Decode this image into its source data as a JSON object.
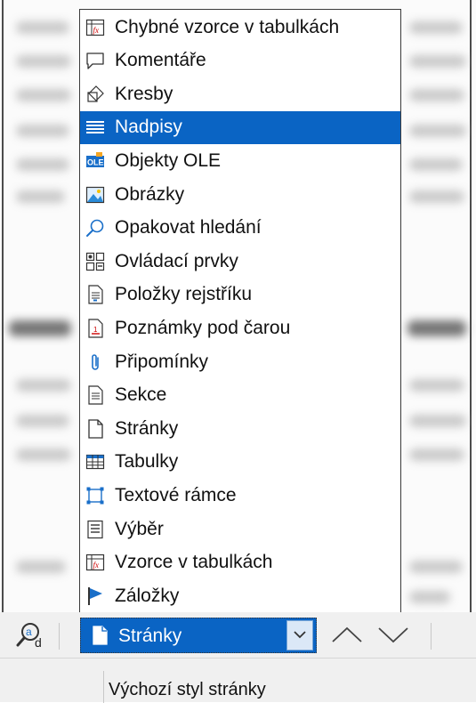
{
  "navigator_list": {
    "items": [
      {
        "label": "Chybné vzorce v tabulkách",
        "icon": "fx-table-icon",
        "selected": false
      },
      {
        "label": "Komentáře",
        "icon": "comment-icon",
        "selected": false
      },
      {
        "label": "Kresby",
        "icon": "drawing-icon",
        "selected": false
      },
      {
        "label": "Nadpisy",
        "icon": "headings-icon",
        "selected": true
      },
      {
        "label": "Objekty OLE",
        "icon": "ole-icon",
        "selected": false
      },
      {
        "label": "Obrázky",
        "icon": "image-icon",
        "selected": false
      },
      {
        "label": "Opakovat hledání",
        "icon": "search-icon",
        "selected": false
      },
      {
        "label": "Ovládací prvky",
        "icon": "form-controls-icon",
        "selected": false
      },
      {
        "label": "Položky rejstříku",
        "icon": "index-entry-icon",
        "selected": false
      },
      {
        "label": "Poznámky pod čarou",
        "icon": "footnote-icon",
        "selected": false
      },
      {
        "label": "Připomínky",
        "icon": "paperclip-icon",
        "selected": false
      },
      {
        "label": "Sekce",
        "icon": "section-icon",
        "selected": false
      },
      {
        "label": "Stránky",
        "icon": "page-icon",
        "selected": false
      },
      {
        "label": "Tabulky",
        "icon": "table-icon",
        "selected": false
      },
      {
        "label": "Textové rámce",
        "icon": "text-frame-icon",
        "selected": false
      },
      {
        "label": "Výběr",
        "icon": "selection-icon",
        "selected": false
      },
      {
        "label": "Vzorce v tabulkách",
        "icon": "fx-table-icon",
        "selected": false
      },
      {
        "label": "Záložky",
        "icon": "bookmark-flag-icon",
        "selected": false
      }
    ]
  },
  "toolbar": {
    "combo_value": "Stránky",
    "combo_icon": "page-icon"
  },
  "statusbar": {
    "page_style": "Výchozí styl stránky"
  },
  "colors": {
    "selection": "#0a64c4",
    "selection_text": "#ffffff",
    "icon_blue": "#1a6fc9"
  }
}
